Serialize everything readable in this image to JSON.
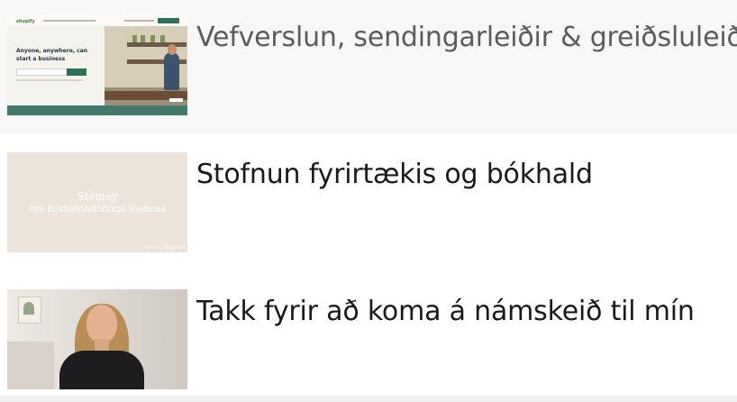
{
  "lessons": [
    {
      "title": "Vefverslun, sendingarleiðir & greiðsluleiðir",
      "active": true,
      "title_color": "#5c5c5c",
      "thumbnail": {
        "logo": "shopify",
        "headline": "Anyone, anywhere, can start a business"
      }
    },
    {
      "title": "Stofnun fyrirtækis og bókhald",
      "active": false,
      "title_color": "#1a1a1a",
      "thumbnail": {
        "name": "Steiney",
        "subtitle": "Frá bókhaldsstofunni Stemma",
        "watermark": "oksun.r@gmail"
      }
    },
    {
      "title": "Takk fyrir að koma á námskeið til mín",
      "active": false,
      "title_color": "#1a1a1a",
      "thumbnail": {}
    }
  ]
}
